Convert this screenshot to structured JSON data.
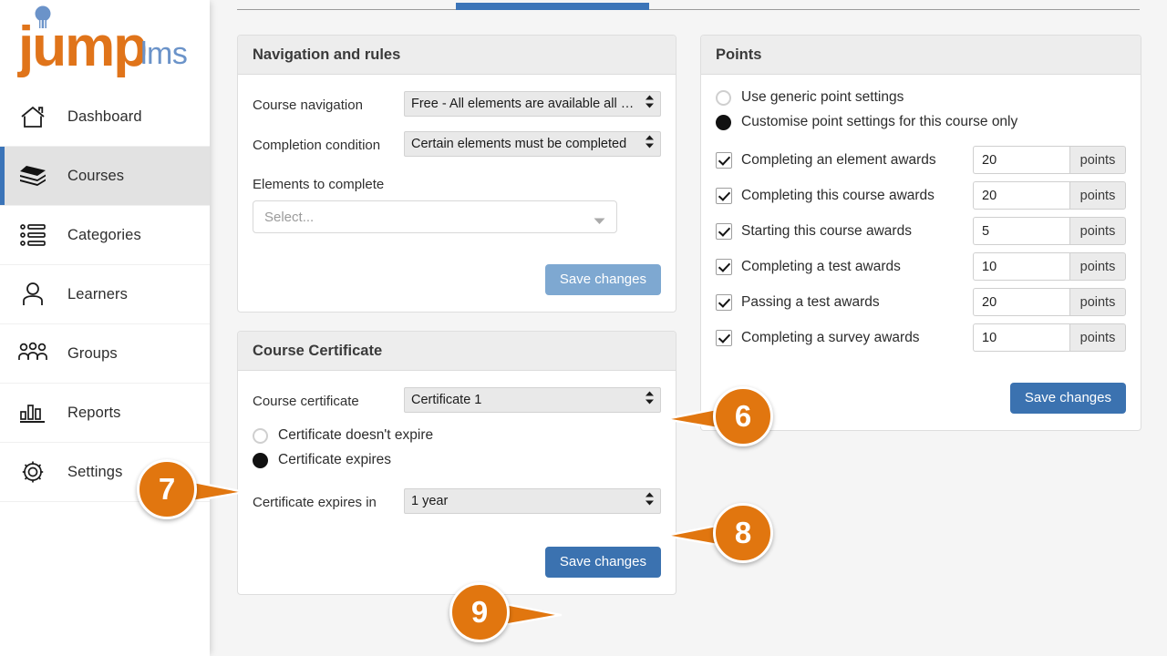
{
  "brand": {
    "name": "jumplms",
    "word_mark": "jump",
    "suffix": "lms"
  },
  "sidebar": {
    "items": [
      {
        "label": "Dashboard",
        "icon": "home-icon",
        "active": false
      },
      {
        "label": "Courses",
        "icon": "books-icon",
        "active": true
      },
      {
        "label": "Categories",
        "icon": "list-icon",
        "active": false
      },
      {
        "label": "Learners",
        "icon": "user-icon",
        "active": false
      },
      {
        "label": "Groups",
        "icon": "group-icon",
        "active": false
      },
      {
        "label": "Reports",
        "icon": "bar-chart-icon",
        "active": false
      },
      {
        "label": "Settings",
        "icon": "gear-icon",
        "active": false
      }
    ]
  },
  "colors": {
    "accent_orange": "#e1760f",
    "primary_blue": "#3b72b0",
    "muted_blue": "#7ea8d1",
    "tab_blue": "#3b74b8",
    "panel_header": "#ededed",
    "page_bg": "#f5f5f5"
  },
  "navigation_rules": {
    "title": "Navigation and rules",
    "course_navigation": {
      "label": "Course navigation",
      "value": "Free - All elements are available all the ...",
      "options": [
        "Free - All elements are available all the ..."
      ]
    },
    "completion_condition": {
      "label": "Completion condition",
      "value": "Certain elements must be completed",
      "options": [
        "Certain elements must be completed"
      ]
    },
    "elements_to_complete": {
      "label": "Elements to complete",
      "placeholder": "Select...",
      "value": ""
    },
    "save_label": "Save changes"
  },
  "course_certificate": {
    "title": "Course Certificate",
    "course_certificate": {
      "label": "Course certificate",
      "value": "Certificate 1",
      "options": [
        "Certificate 1"
      ]
    },
    "expiry_options": [
      {
        "label": "Certificate doesn't expire",
        "selected": false
      },
      {
        "label": "Certificate expires",
        "selected": true
      }
    ],
    "expires_in": {
      "label": "Certificate expires in",
      "value": "1 year",
      "options": [
        "1 year"
      ]
    },
    "save_label": "Save changes"
  },
  "points": {
    "title": "Points",
    "mode_options": [
      {
        "label": "Use generic point settings",
        "selected": false
      },
      {
        "label": "Customise point settings for this course only",
        "selected": true
      }
    ],
    "unit_label": "points",
    "rules": [
      {
        "label": "Completing an element awards",
        "checked": true,
        "value": "20"
      },
      {
        "label": "Completing this course awards",
        "checked": true,
        "value": "20"
      },
      {
        "label": "Starting this course awards",
        "checked": true,
        "value": "5"
      },
      {
        "label": "Completing a test awards",
        "checked": true,
        "value": "10"
      },
      {
        "label": "Passing a test awards",
        "checked": true,
        "value": "20"
      },
      {
        "label": "Completing a survey awards",
        "checked": true,
        "value": "10"
      }
    ],
    "save_label": "Save changes"
  },
  "callouts": [
    {
      "number": "6",
      "direction": "left"
    },
    {
      "number": "7",
      "direction": "right"
    },
    {
      "number": "8",
      "direction": "left"
    },
    {
      "number": "9",
      "direction": "right"
    }
  ]
}
